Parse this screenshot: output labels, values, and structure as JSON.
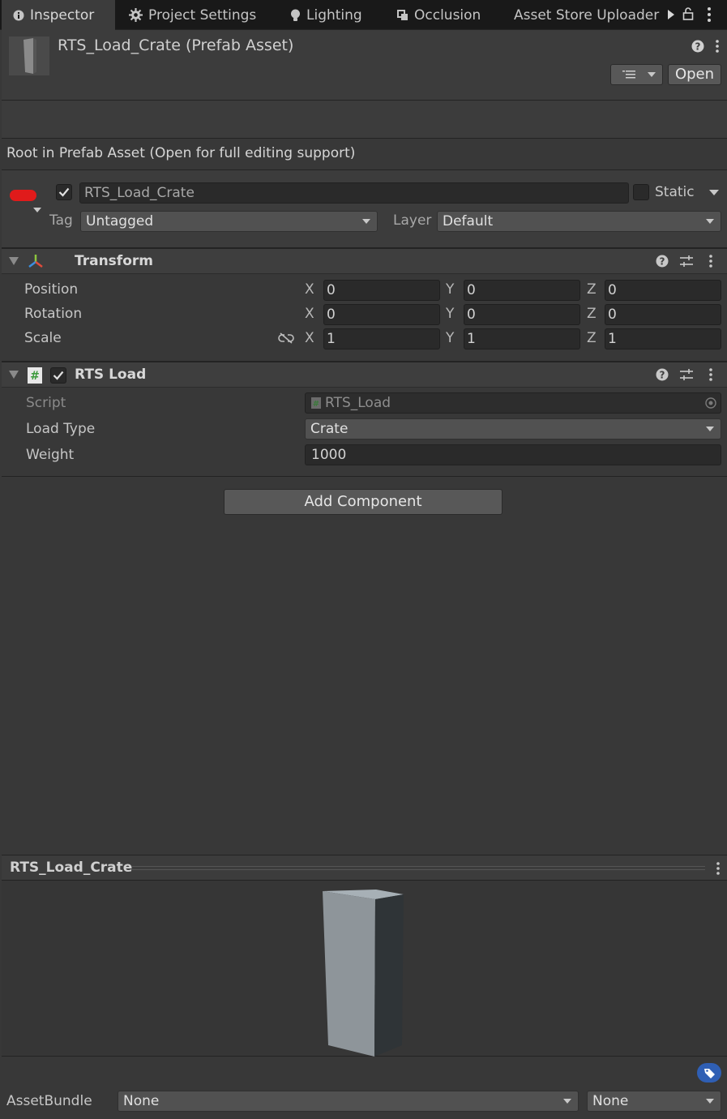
{
  "tabs": [
    {
      "label": "Inspector",
      "icon": "info-icon",
      "active": true
    },
    {
      "label": "Project Settings",
      "icon": "gear-icon",
      "active": false
    },
    {
      "label": "Lighting",
      "icon": "lightbulb-icon",
      "active": false
    },
    {
      "label": "Occlusion",
      "icon": "occlusion-icon",
      "active": false
    },
    {
      "label": "Asset Store Uploader",
      "icon": "",
      "active": false
    }
  ],
  "header": {
    "title": "RTS_Load_Crate (Prefab Asset)",
    "open_label": "Open"
  },
  "root_info": "Root in Prefab Asset (Open for full editing support)",
  "gameobject": {
    "enabled": true,
    "name": "RTS_Load_Crate",
    "static_label": "Static",
    "tag_label": "Tag",
    "tag_value": "Untagged",
    "layer_label": "Layer",
    "layer_value": "Default"
  },
  "transform": {
    "title": "Transform",
    "rows": [
      {
        "label": "Position",
        "x": "0",
        "y": "0",
        "z": "0"
      },
      {
        "label": "Rotation",
        "x": "0",
        "y": "0",
        "z": "0"
      },
      {
        "label": "Scale",
        "x": "1",
        "y": "1",
        "z": "1"
      }
    ],
    "axes": {
      "x": "X",
      "y": "Y",
      "z": "Z"
    }
  },
  "rts_load": {
    "title": "RTS Load",
    "enabled": true,
    "script_label": "Script",
    "script_value": "RTS_Load",
    "load_type_label": "Load Type",
    "load_type_value": "Crate",
    "weight_label": "Weight",
    "weight_value": "1000"
  },
  "add_component_label": "Add Component",
  "preview": {
    "title": "RTS_Load_Crate"
  },
  "asset_bundle": {
    "label": "AssetBundle",
    "name_value": "None",
    "variant_value": "None"
  },
  "colors": {
    "background": "#383838",
    "tab_bar": "#191919",
    "field": "#2a2a2a",
    "icon_red": "#e01b1b",
    "tag_blue": "#2f5fb4"
  }
}
